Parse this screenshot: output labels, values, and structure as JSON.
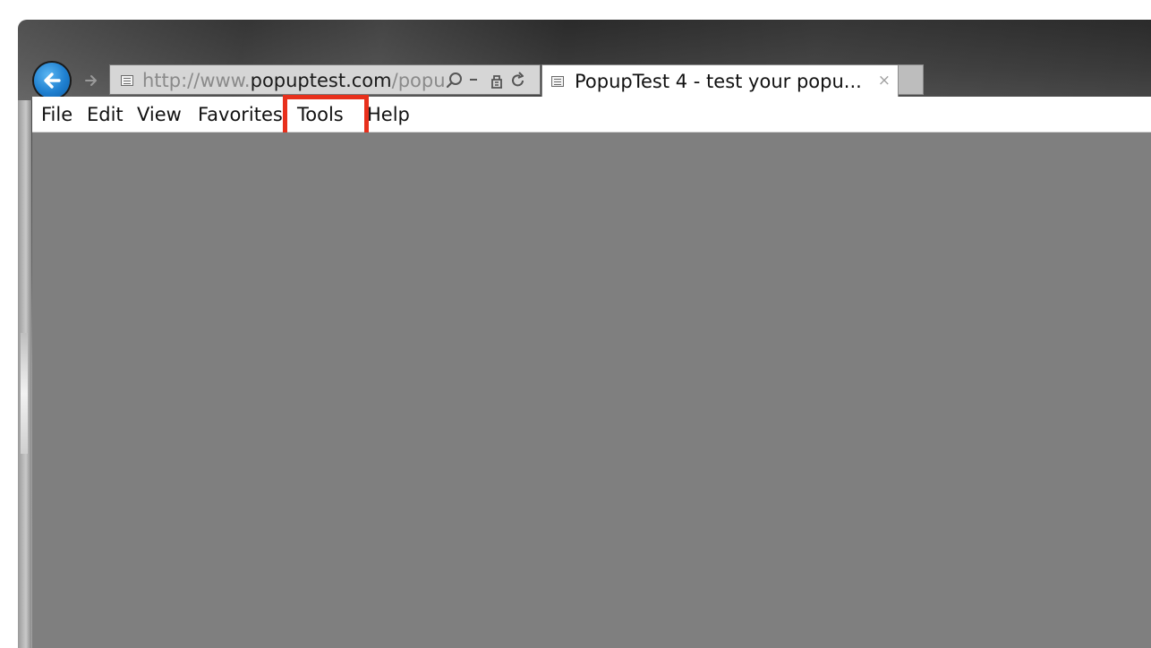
{
  "window": {
    "frame_color": "#3a3a3a",
    "content_color": "#7f7f7f"
  },
  "nav": {
    "back_icon": "back-arrow-icon",
    "forward_icon": "forward-arrow-icon"
  },
  "address_bar": {
    "url_prefix": "http://www.",
    "url_domain": "popuptest.com",
    "url_suffix": "/popu",
    "site_icon": "page-icon",
    "search_icon": "search-icon",
    "dropdown_icon": "dropdown-arrow-icon",
    "compat_icon": "compatibility-view-icon",
    "refresh_icon": "refresh-icon"
  },
  "tabs": [
    {
      "title": "PopupTest 4 - test your popu...",
      "close_symbol": "×",
      "icon": "page-icon"
    }
  ],
  "menubar": {
    "items": [
      "File",
      "Edit",
      "View",
      "Favorites",
      "Tools",
      "Help"
    ]
  },
  "annotation": {
    "highlighted_item": "Tools",
    "color": "#e8301c"
  }
}
